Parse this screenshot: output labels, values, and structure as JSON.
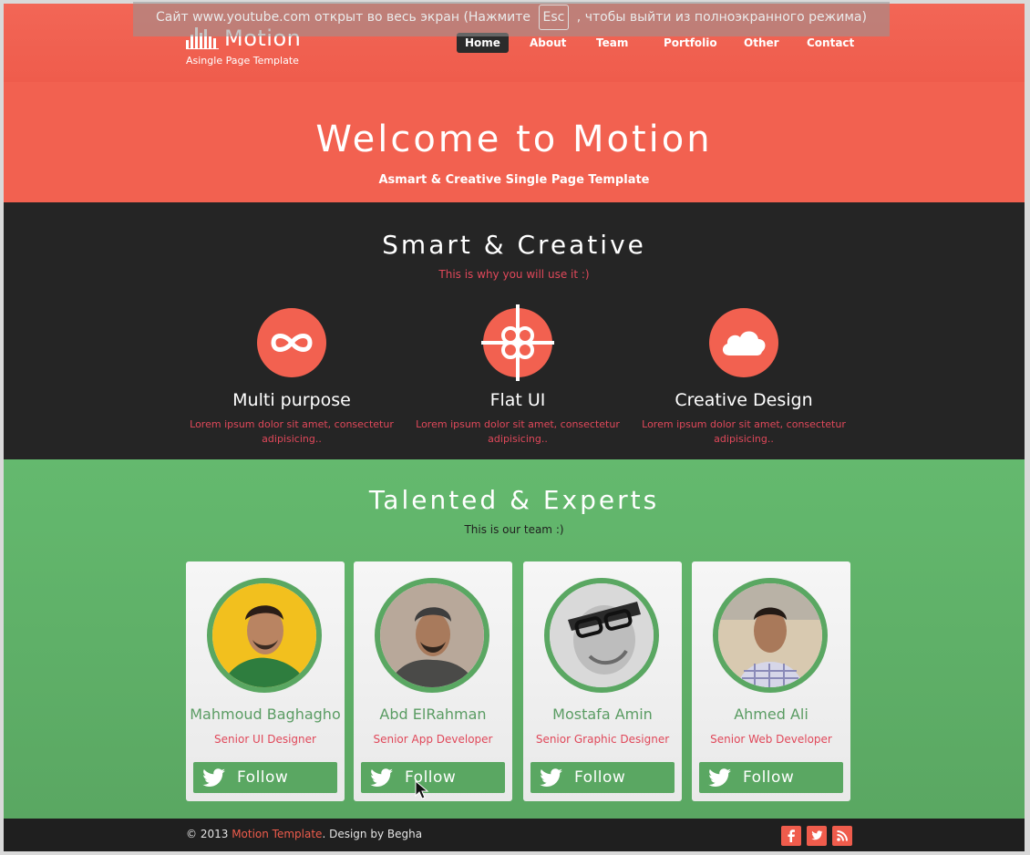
{
  "fullscreen_notice": {
    "before": "Сайт www.youtube.com открыт во весь экран (Нажмите",
    "key": "Esc",
    "after": ", чтобы выйти из полноэкранного режима)"
  },
  "logo": {
    "name": "Motion",
    "tagline": "Asingle Page Template"
  },
  "nav": {
    "items": [
      "Home",
      "About",
      "Team",
      "Portfolio",
      "Other",
      "Contact"
    ],
    "active": "Home"
  },
  "hero": {
    "title": "Welcome to Motion",
    "subtitle": "Asmart & Creative Single Page Template"
  },
  "features_section": {
    "title": "Smart & Creative",
    "subtitle": "This is why you will use it :)",
    "items": [
      {
        "title": "Multi purpose",
        "icon": "infinity-icon",
        "text": "Lorem ipsum dolor sit amet, consectetur adipisicing.."
      },
      {
        "title": "Flat UI",
        "icon": "flower-crosshair-icon",
        "text": "Lorem ipsum dolor sit amet, consectetur adipisicing.."
      },
      {
        "title": "Creative Design",
        "icon": "cloud-icon",
        "text": "Lorem ipsum dolor sit amet, consectetur adipisicing.."
      }
    ]
  },
  "team_section": {
    "title": "Talented & Experts",
    "subtitle": "This is our team :)",
    "members": [
      {
        "name": "Mahmoud Baghagho",
        "role": "Senior UI Designer",
        "follow_label": "Follow"
      },
      {
        "name": "Abd ElRahman",
        "role": "Senior App Developer",
        "follow_label": "Follow"
      },
      {
        "name": "Mostafa Amin",
        "role": "Senior Graphic Designer",
        "follow_label": "Follow"
      },
      {
        "name": "Ahmed Ali",
        "role": "Senior Web Developer",
        "follow_label": "Follow"
      }
    ]
  },
  "footer": {
    "copyright": "© 2013",
    "brand": "Motion Template",
    "credit": ". Design by Begha",
    "social": [
      "facebook-icon",
      "twitter-icon",
      "rss-icon"
    ]
  },
  "colors": {
    "primary_red": "#f26150",
    "dark": "#252525",
    "green": "#5aa762",
    "accent_pink": "#e0485a"
  }
}
